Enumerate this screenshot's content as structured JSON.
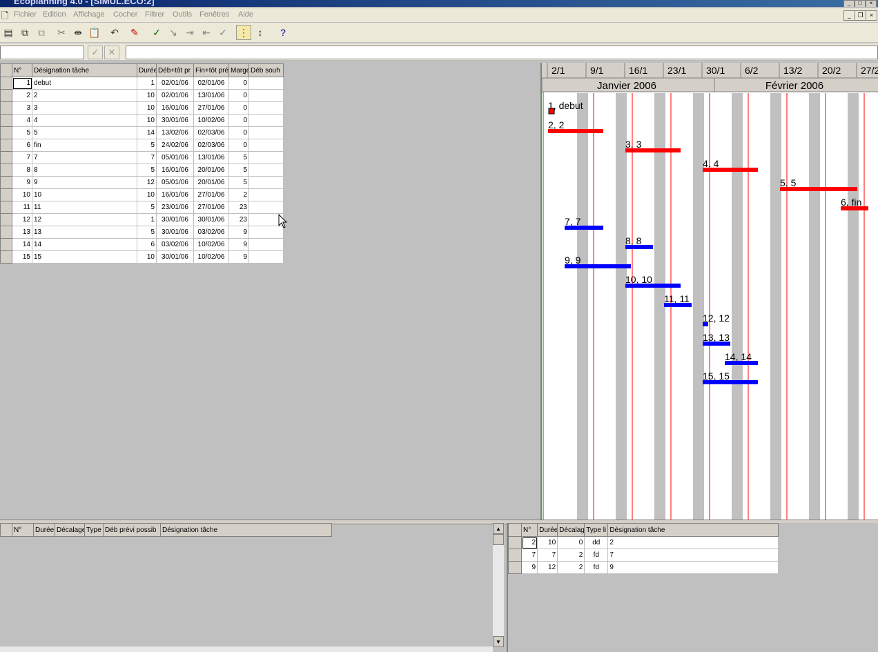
{
  "window": {
    "title": "Ecoplanning 4.0 - [SIMUL.ECO:2]"
  },
  "menu": [
    "Fichier",
    "Edition",
    "Affichage",
    "Cocher",
    "Filtrer",
    "Outils",
    "Fenêtres",
    "Aide"
  ],
  "toolbar_icons": [
    "new-doc-icon",
    "copy-task-icon",
    "paste-task-icon",
    "cut-icon",
    "split-icon",
    "paste-icon",
    "undo-icon",
    "highlight-icon",
    "add-link-icon",
    "link-icon",
    "indent-icon",
    "outdent-icon",
    "check-all-icon",
    "sort-icon",
    "renumber-icon",
    "help-icon"
  ],
  "formula": {
    "accept": "✓",
    "cancel": "✕",
    "value": ""
  },
  "task_table": {
    "columns": [
      "N°",
      "Désignation tâche",
      "Durée",
      "Déb+tôt pr",
      "Fin+tôt pré",
      "Marge",
      "Déb souh"
    ],
    "rows": [
      [
        "1",
        "debut",
        "1",
        "02/01/06",
        "02/01/06",
        "0",
        ""
      ],
      [
        "2",
        "2",
        "10",
        "02/01/06",
        "13/01/06",
        "0",
        ""
      ],
      [
        "3",
        "3",
        "10",
        "16/01/06",
        "27/01/06",
        "0",
        ""
      ],
      [
        "4",
        "4",
        "10",
        "30/01/06",
        "10/02/06",
        "0",
        ""
      ],
      [
        "5",
        "5",
        "14",
        "13/02/06",
        "02/03/06",
        "0",
        ""
      ],
      [
        "6",
        "fin",
        "5",
        "24/02/06",
        "02/03/06",
        "0",
        ""
      ],
      [
        "7",
        "7",
        "7",
        "05/01/06",
        "13/01/06",
        "5",
        ""
      ],
      [
        "8",
        "8",
        "5",
        "16/01/06",
        "20/01/06",
        "5",
        ""
      ],
      [
        "9",
        "9",
        "12",
        "05/01/06",
        "20/01/06",
        "5",
        ""
      ],
      [
        "10",
        "10",
        "10",
        "16/01/06",
        "27/01/06",
        "2",
        ""
      ],
      [
        "11",
        "11",
        "5",
        "23/01/06",
        "27/01/06",
        "23",
        ""
      ],
      [
        "12",
        "12",
        "1",
        "30/01/06",
        "30/01/06",
        "23",
        ""
      ],
      [
        "13",
        "13",
        "5",
        "30/01/06",
        "03/02/06",
        "9",
        ""
      ],
      [
        "14",
        "14",
        "6",
        "03/02/06",
        "10/02/06",
        "9",
        ""
      ],
      [
        "15",
        "15",
        "10",
        "30/01/06",
        "10/02/06",
        "9",
        ""
      ]
    ]
  },
  "gantt": {
    "weeks": [
      "2/1",
      "9/1",
      "16/1",
      "23/1",
      "30/1",
      "6/2",
      "13/2",
      "20/2",
      "27/2"
    ],
    "months": [
      "Janvier 2006",
      "Février 2006"
    ],
    "bars": [
      {
        "label": "1, debut",
        "start": "02/01/06",
        "days": 1,
        "critical": true
      },
      {
        "label": "2, 2",
        "start": "02/01/06",
        "days": 10,
        "critical": true
      },
      {
        "label": "3, 3",
        "start": "16/01/06",
        "days": 10,
        "critical": true
      },
      {
        "label": "4, 4",
        "start": "30/01/06",
        "days": 10,
        "critical": true
      },
      {
        "label": "5, 5",
        "start": "13/02/06",
        "days": 14,
        "critical": true
      },
      {
        "label": "6, fin",
        "start": "24/02/06",
        "days": 5,
        "critical": true
      },
      {
        "label": "7, 7",
        "start": "05/01/06",
        "days": 7,
        "critical": false
      },
      {
        "label": "8, 8",
        "start": "16/01/06",
        "days": 5,
        "critical": false
      },
      {
        "label": "9, 9",
        "start": "05/01/06",
        "days": 12,
        "critical": false
      },
      {
        "label": "10, 10",
        "start": "16/01/06",
        "days": 10,
        "critical": false
      },
      {
        "label": "11, 11",
        "start": "23/01/06",
        "days": 5,
        "critical": false
      },
      {
        "label": "12, 12",
        "start": "30/01/06",
        "days": 1,
        "critical": false
      },
      {
        "label": "13, 13",
        "start": "30/01/06",
        "days": 5,
        "critical": false
      },
      {
        "label": "14, 14",
        "start": "03/02/06",
        "days": 6,
        "critical": false
      },
      {
        "label": "15, 15",
        "start": "30/01/06",
        "days": 10,
        "critical": false
      }
    ],
    "colors": {
      "critical": "#ff0000",
      "normal": "#0000ff",
      "weekend": "#c0c0c0",
      "grid_line": "#ff0000"
    }
  },
  "successors_table": {
    "columns": [
      "N°",
      "Durée",
      "Décalage",
      "Type",
      "Déb prévi possib",
      "Désignation tâche"
    ],
    "rows": []
  },
  "predecessors_table": {
    "columns": [
      "N°",
      "Durée",
      "Décalag",
      "Type li",
      "Désignation tâche"
    ],
    "rows": [
      [
        "2",
        "10",
        "0",
        "dd",
        "2"
      ],
      [
        "7",
        "7",
        "2",
        "fd",
        "7"
      ],
      [
        "9",
        "12",
        "2",
        "fd",
        "9"
      ]
    ]
  }
}
